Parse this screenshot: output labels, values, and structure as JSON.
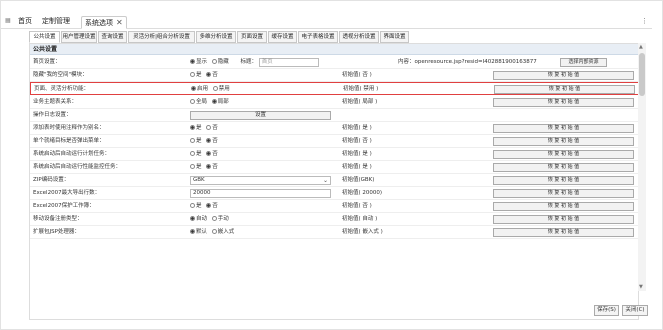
{
  "top_tabs": [
    {
      "label": "首页"
    },
    {
      "label": "定制管理"
    },
    {
      "label": "系统选项"
    }
  ],
  "sub_tabs": [
    "公共设置",
    "用户管理设置",
    "查询设置",
    "灵活分析|组合分析设置",
    "多维分析设置",
    "页面设置",
    "缓存设置",
    "电子表格设置",
    "透视分析设置",
    "界面设置"
  ],
  "section_title": "公共设置",
  "restore_label": "恢 复 初 始 值",
  "rows": [
    {
      "label": "首页设置：",
      "options": [
        "显示",
        "隐藏"
      ],
      "selected": 0,
      "title_label": "标题：",
      "title_placeholder": "首页",
      "content_text": "内容：openresource.jsp?resid=I402881900163877",
      "select_resource": "选择内部资源"
    },
    {
      "label": "隐藏\"我的空间\"模块：",
      "options": [
        "是",
        "否"
      ],
      "selected": 1,
      "initial": "初始值( 否 )"
    },
    {
      "label": "页面、灵活分析功能：",
      "options": [
        "启用",
        "禁用"
      ],
      "selected": 0,
      "initial": "初始值( 禁用 )",
      "highlight": true
    },
    {
      "label": "业务主题表关系：",
      "options": [
        "全局",
        "局部"
      ],
      "selected": 1,
      "initial": "初始值( 局部 )"
    },
    {
      "label": "操作日志设置：",
      "button": "设置"
    },
    {
      "label": "添加表时使用注释作为别名：",
      "options": [
        "是",
        "否"
      ],
      "selected": 0,
      "initial": "初始值( 是 )"
    },
    {
      "label": "单个就绪目标是否弹出菜单：",
      "options": [
        "是",
        "否"
      ],
      "selected": 1,
      "initial": "初始值( 否 )"
    },
    {
      "label": "系统启动后自动运行计划任务：",
      "options": [
        "是",
        "否"
      ],
      "selected": 0,
      "initial": "初始值( 是 )"
    },
    {
      "label": "系统启动后自动运行性能监控任务：",
      "options": [
        "是",
        "否"
      ],
      "selected": 0,
      "initial": "初始值( 是 )"
    },
    {
      "label": "ZIP编码设置：",
      "select_value": "GBK",
      "initial": "初始值(GBK)"
    },
    {
      "label": "Excel2007最大导出行数：",
      "text_value": "20000",
      "initial": "初始值( 20000)"
    },
    {
      "label": "Excel2007保护工作簿：",
      "options": [
        "是",
        "否"
      ],
      "selected": 1,
      "initial": "初始值( 否 )"
    },
    {
      "label": "移动设备注册类型：",
      "options": [
        "自动",
        "手动"
      ],
      "selected": 0,
      "initial": "初始值( 自动 )"
    },
    {
      "label": "扩展包JSP处理器：",
      "options": [
        "默认",
        "嵌入式"
      ],
      "selected": 0,
      "initial": "初始值( 嵌入式 )"
    }
  ],
  "footer": {
    "save": "保存(S)",
    "close": "关闭(C)"
  }
}
